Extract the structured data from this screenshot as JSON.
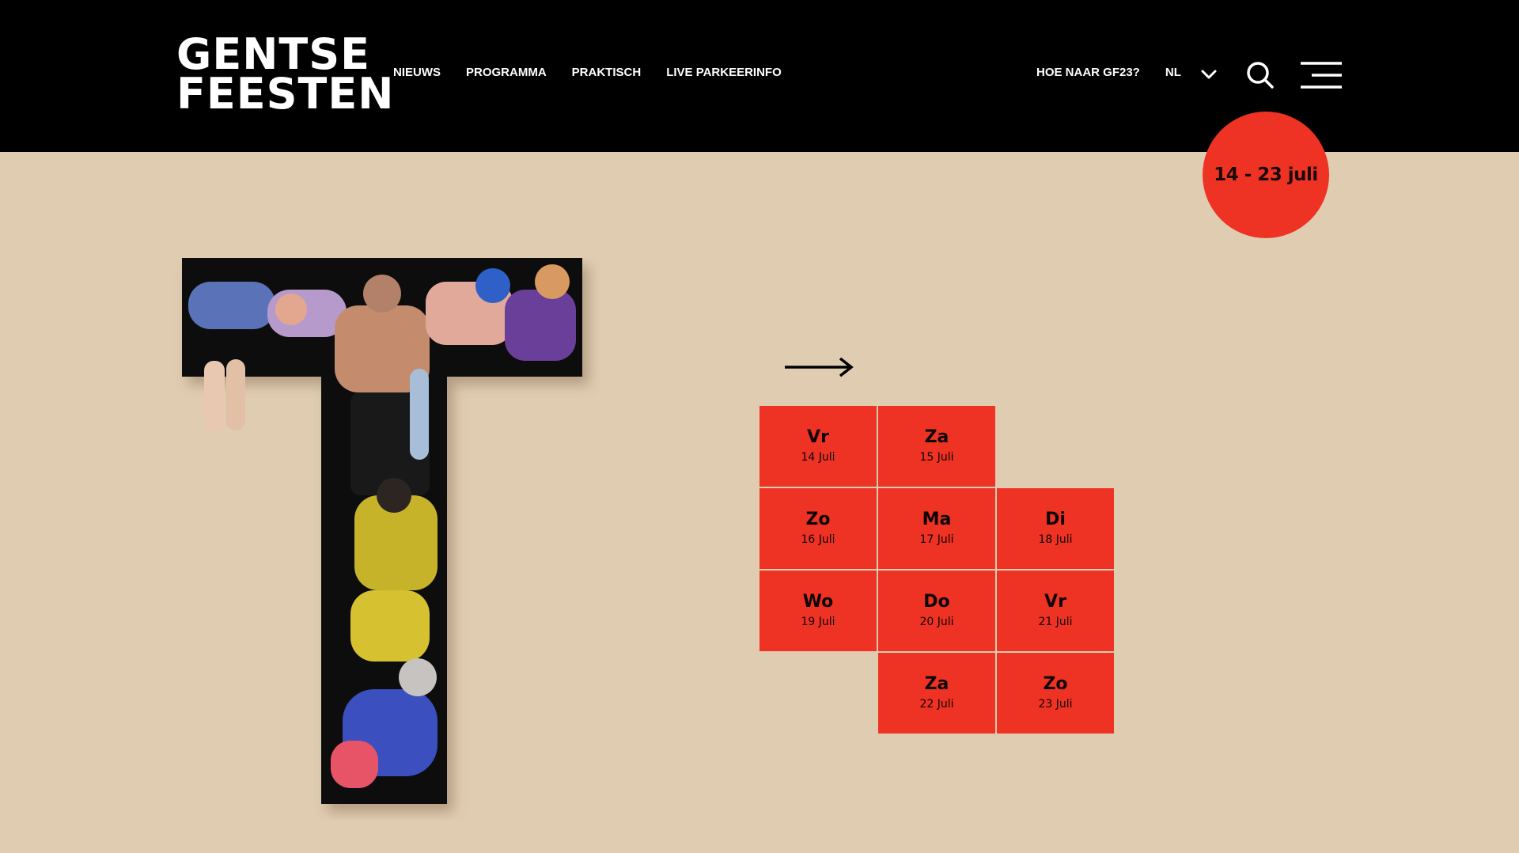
{
  "logo": {
    "line1": "GENTSE",
    "line2": "FEESTEN"
  },
  "nav": {
    "items": [
      "NIEUWS",
      "PROGRAMMA",
      "PRAKTISCH",
      "LIVE PARKEERINFO"
    ]
  },
  "utility": {
    "route": "HOE NAAR GF23?",
    "language": "NL"
  },
  "badge": {
    "dates": "14 - 23 juli"
  },
  "colors": {
    "accent": "#ee3224",
    "background": "#e0ccb1",
    "header": "#000000"
  },
  "days": [
    {
      "name": "Vr",
      "date": "14 Juli"
    },
    {
      "name": "Za",
      "date": "15 Juli"
    },
    {
      "name": "Zo",
      "date": "16 Juli"
    },
    {
      "name": "Ma",
      "date": "17 Juli"
    },
    {
      "name": "Di",
      "date": "18 Juli"
    },
    {
      "name": "Wo",
      "date": "19 Juli"
    },
    {
      "name": "Do",
      "date": "20 Juli"
    },
    {
      "name": "Vr",
      "date": "21 Juli"
    },
    {
      "name": "Za",
      "date": "22 Juli"
    },
    {
      "name": "Zo",
      "date": "23 Juli"
    }
  ],
  "icons": {
    "language_toggle": "chevron-down-icon",
    "search": "search-icon",
    "menu": "hamburger-menu-icon",
    "arrow": "arrow-right-icon"
  }
}
